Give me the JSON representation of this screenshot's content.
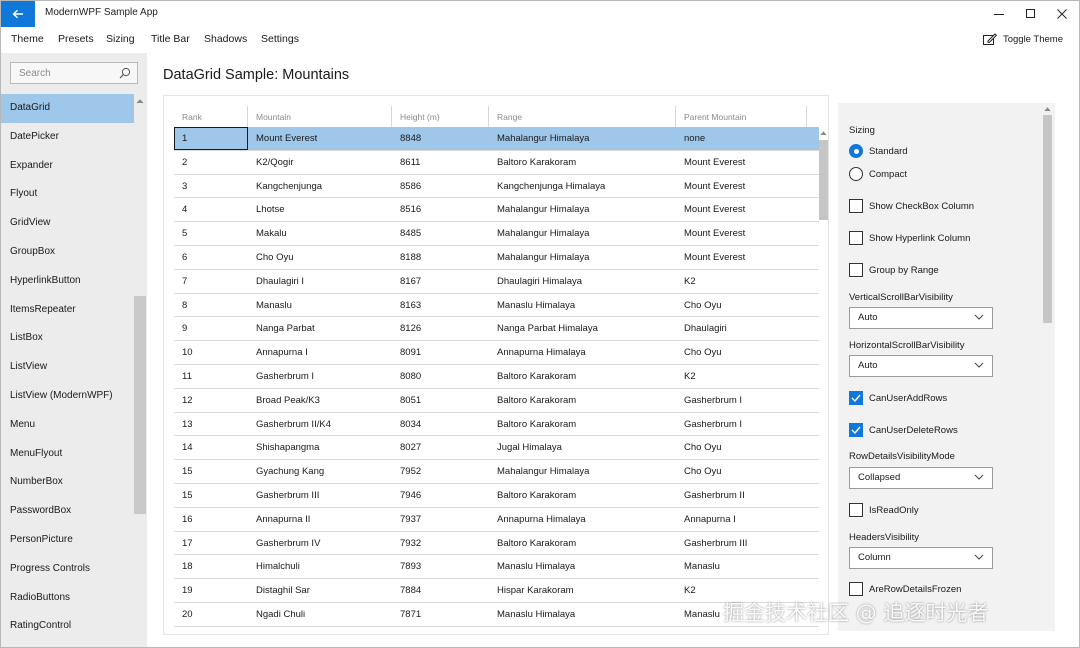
{
  "app": {
    "title": "ModernWPF Sample App"
  },
  "menu": {
    "items": [
      "Theme",
      "Presets",
      "Sizing",
      "Title Bar",
      "Shadows",
      "Settings"
    ],
    "toggle_theme": "Toggle Theme"
  },
  "search": {
    "placeholder": "Search"
  },
  "sidebar": {
    "items": [
      {
        "label": "DataGrid",
        "selected": true
      },
      {
        "label": "DatePicker"
      },
      {
        "label": "Expander"
      },
      {
        "label": "Flyout"
      },
      {
        "label": "GridView"
      },
      {
        "label": "GroupBox"
      },
      {
        "label": "HyperlinkButton"
      },
      {
        "label": "ItemsRepeater"
      },
      {
        "label": "ListBox"
      },
      {
        "label": "ListView"
      },
      {
        "label": "ListView (ModernWPF)"
      },
      {
        "label": "Menu"
      },
      {
        "label": "MenuFlyout"
      },
      {
        "label": "NumberBox"
      },
      {
        "label": "PasswordBox"
      },
      {
        "label": "PersonPicture"
      },
      {
        "label": "Progress Controls"
      },
      {
        "label": "RadioButtons"
      },
      {
        "label": "RatingControl"
      }
    ]
  },
  "page": {
    "title": "DataGrid Sample: Mountains"
  },
  "grid": {
    "columns": [
      "Rank",
      "Mountain",
      "Height (m)",
      "Range",
      "Parent Mountain"
    ],
    "rows": [
      [
        "1",
        "Mount Everest",
        "8848",
        "Mahalangur Himalaya",
        "none"
      ],
      [
        "2",
        "K2/Qogir",
        "8611",
        "Baltoro Karakoram",
        "Mount Everest"
      ],
      [
        "3",
        "Kangchenjunga",
        "8586",
        "Kangchenjunga Himalaya",
        "Mount Everest"
      ],
      [
        "4",
        "Lhotse",
        "8516",
        "Mahalangur Himalaya",
        "Mount Everest"
      ],
      [
        "5",
        "Makalu",
        "8485",
        "Mahalangur Himalaya",
        "Mount Everest"
      ],
      [
        "6",
        "Cho Oyu",
        "8188",
        "Mahalangur Himalaya",
        "Mount Everest"
      ],
      [
        "7",
        "Dhaulagiri I",
        "8167",
        "Dhaulagiri Himalaya",
        "K2"
      ],
      [
        "8",
        "Manaslu",
        "8163",
        "Manaslu Himalaya",
        "Cho Oyu"
      ],
      [
        "9",
        "Nanga Parbat",
        "8126",
        "Nanga Parbat Himalaya",
        "Dhaulagiri"
      ],
      [
        "10",
        "Annapurna I",
        "8091",
        "Annapurna Himalaya",
        "Cho Oyu"
      ],
      [
        "11",
        "Gasherbrum I",
        "8080",
        "Baltoro Karakoram",
        "K2"
      ],
      [
        "12",
        "Broad Peak/K3",
        "8051",
        "Baltoro Karakoram",
        "Gasherbrum I"
      ],
      [
        "13",
        "Gasherbrum II/K4",
        "8034",
        "Baltoro Karakoram",
        "Gasherbrum I"
      ],
      [
        "14",
        "Shishapangma",
        "8027",
        "Jugal Himalaya",
        "Cho Oyu"
      ],
      [
        "15",
        "Gyachung Kang",
        "7952",
        "Mahalangur Himalaya",
        "Cho Oyu"
      ],
      [
        "15",
        "Gasherbrum III",
        "7946",
        "Baltoro Karakoram",
        "Gasherbrum II"
      ],
      [
        "16",
        "Annapurna II",
        "7937",
        "Annapurna Himalaya",
        "Annapurna I"
      ],
      [
        "17",
        "Gasherbrum IV",
        "7932",
        "Baltoro Karakoram",
        "Gasherbrum III"
      ],
      [
        "18",
        "Himalchuli",
        "7893",
        "Manaslu Himalaya",
        "Manaslu"
      ],
      [
        "19",
        "Distaghil Sar",
        "7884",
        "Hispar Karakoram",
        "K2"
      ],
      [
        "20",
        "Ngadi Chuli",
        "7871",
        "Manaslu Himalaya",
        "Manaslu"
      ]
    ],
    "selected_row": 0
  },
  "options": {
    "sizing_label": "Sizing",
    "sizing_standard": "Standard",
    "sizing_compact": "Compact",
    "show_checkbox_column": "Show CheckBox Column",
    "show_hyperlink_column": "Show Hyperlink Column",
    "group_by_range": "Group by Range",
    "vscroll_label": "VerticalScrollBarVisibility",
    "vscroll_value": "Auto",
    "hscroll_label": "HorizontalScrollBarVisibility",
    "hscroll_value": "Auto",
    "can_user_add_rows": "CanUserAddRows",
    "can_user_delete_rows": "CanUserDeleteRows",
    "row_details_label": "RowDetailsVisibilityMode",
    "row_details_value": "Collapsed",
    "is_read_only": "IsReadOnly",
    "headers_visibility_label": "HeadersVisibility",
    "headers_visibility_value": "Column",
    "are_row_details_frozen": "AreRowDetailsFrozen"
  },
  "watermark": "掘金技术社区 @ 追逐时光者",
  "colors": {
    "accent": "#1078d8",
    "selection": "#9ec7ea",
    "sidebar_bg": "#ececec",
    "panel_bg": "#f2f2f2"
  }
}
